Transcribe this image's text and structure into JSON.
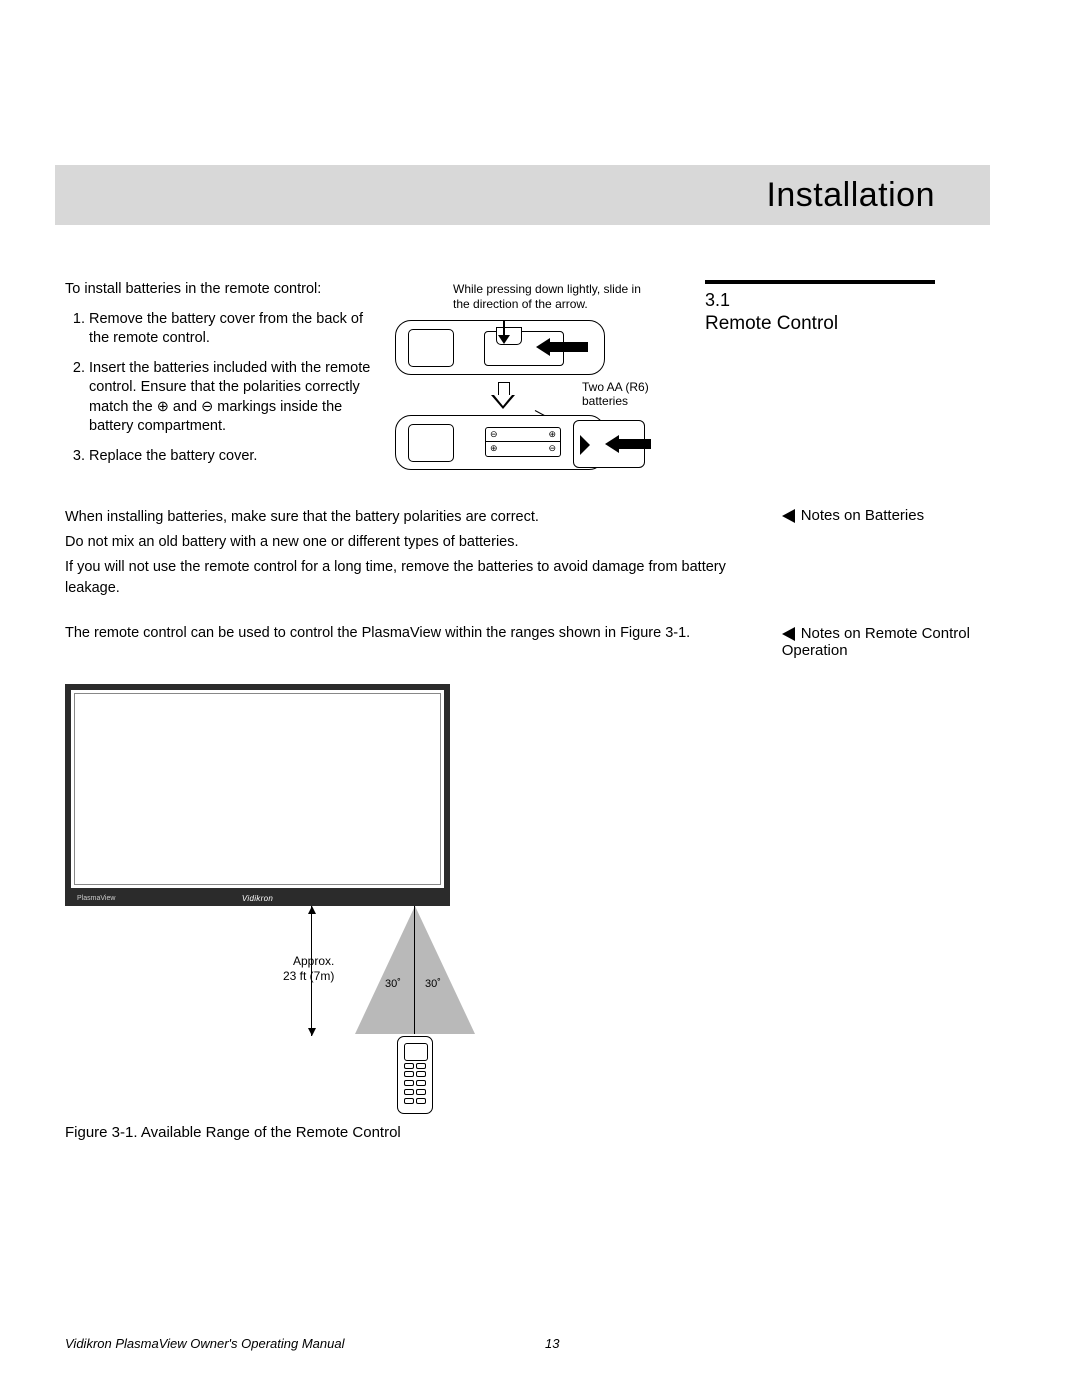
{
  "title": "Installation",
  "section": {
    "number": "3.1",
    "title": "Remote Control"
  },
  "intro": "To install batteries in the remote control:",
  "steps": [
    "Remove the battery cover from the back of the remote control.",
    "Insert the batteries included with the remote control. Ensure that the polarities correctly match the ⊕ and ⊖ markings inside the battery compartment.",
    "Replace the battery cover."
  ],
  "diagram": {
    "slide_caption": "While pressing down lightly, slide in the direction of the arrow.",
    "battery_label": "Two AA (R6) batteries"
  },
  "notes_batteries": {
    "side_label": "Notes on Batteries",
    "items": [
      "When installing batteries, make sure that the battery polarities are correct.",
      "Do not mix an old battery with a new one or different types of batteries.",
      "If you will not use the remote control for a long time, remove the batteries to avoid damage from battery leakage."
    ]
  },
  "notes_remote": {
    "side_label": "Notes on Remote Control Operation",
    "text": "The remote control can be used to control the PlasmaView within the ranges shown in Figure 3-1."
  },
  "figure": {
    "brand": "Vidikron",
    "corner": "PlasmaView",
    "distance_label": "Approx.\n23 ft (7m)",
    "angle_left": "30˚",
    "angle_right": "30˚",
    "caption": "Figure 3-1. Available Range of the Remote Control"
  },
  "footer": {
    "title": "Vidikron PlasmaView Owner's Operating Manual",
    "page": "13"
  }
}
